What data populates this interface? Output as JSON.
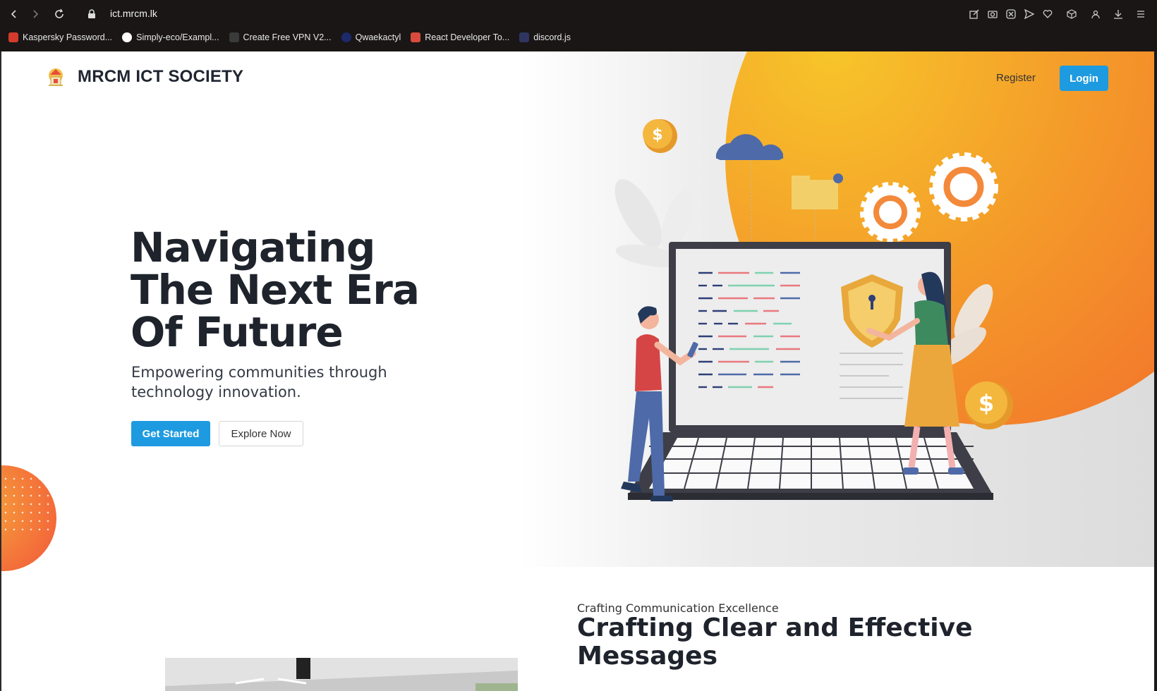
{
  "browser": {
    "url": "ict.mrcm.lk",
    "bookmarks": [
      {
        "label": "Kaspersky Password...",
        "color": "#d33b2c"
      },
      {
        "label": "Simply-eco/Exampl...",
        "color": "#ffffff"
      },
      {
        "label": "Create Free VPN V2...",
        "color": "#3a3a3a"
      },
      {
        "label": "Qwaekactyl",
        "color": "#1b2a6b"
      },
      {
        "label": "React Developer To...",
        "color": "#d94b3d"
      },
      {
        "label": "discord.js",
        "color": "#2f3560"
      }
    ],
    "extension_icons": [
      "edit-icon",
      "camera-icon",
      "x-circle-icon",
      "send-icon",
      "heart-icon",
      "cube-icon",
      "profile-icon",
      "download-icon",
      "menu-icon"
    ]
  },
  "header": {
    "brand": "MRCM ICT SOCIETY",
    "register": "Register",
    "login": "Login"
  },
  "hero": {
    "headline_lines": [
      "Navigating",
      "The Next Era",
      "Of Future"
    ],
    "subtitle": "Empowering communities through technology innovation.",
    "primary_cta": "Get Started",
    "secondary_cta": "Explore Now"
  },
  "section2": {
    "eyebrow": "Crafting Communication Excellence",
    "title": "Crafting Clear and Effective Messages"
  },
  "colors": {
    "accent": "#1e9be0",
    "orange": "#f26a2c",
    "yellow": "#f7c52a"
  }
}
